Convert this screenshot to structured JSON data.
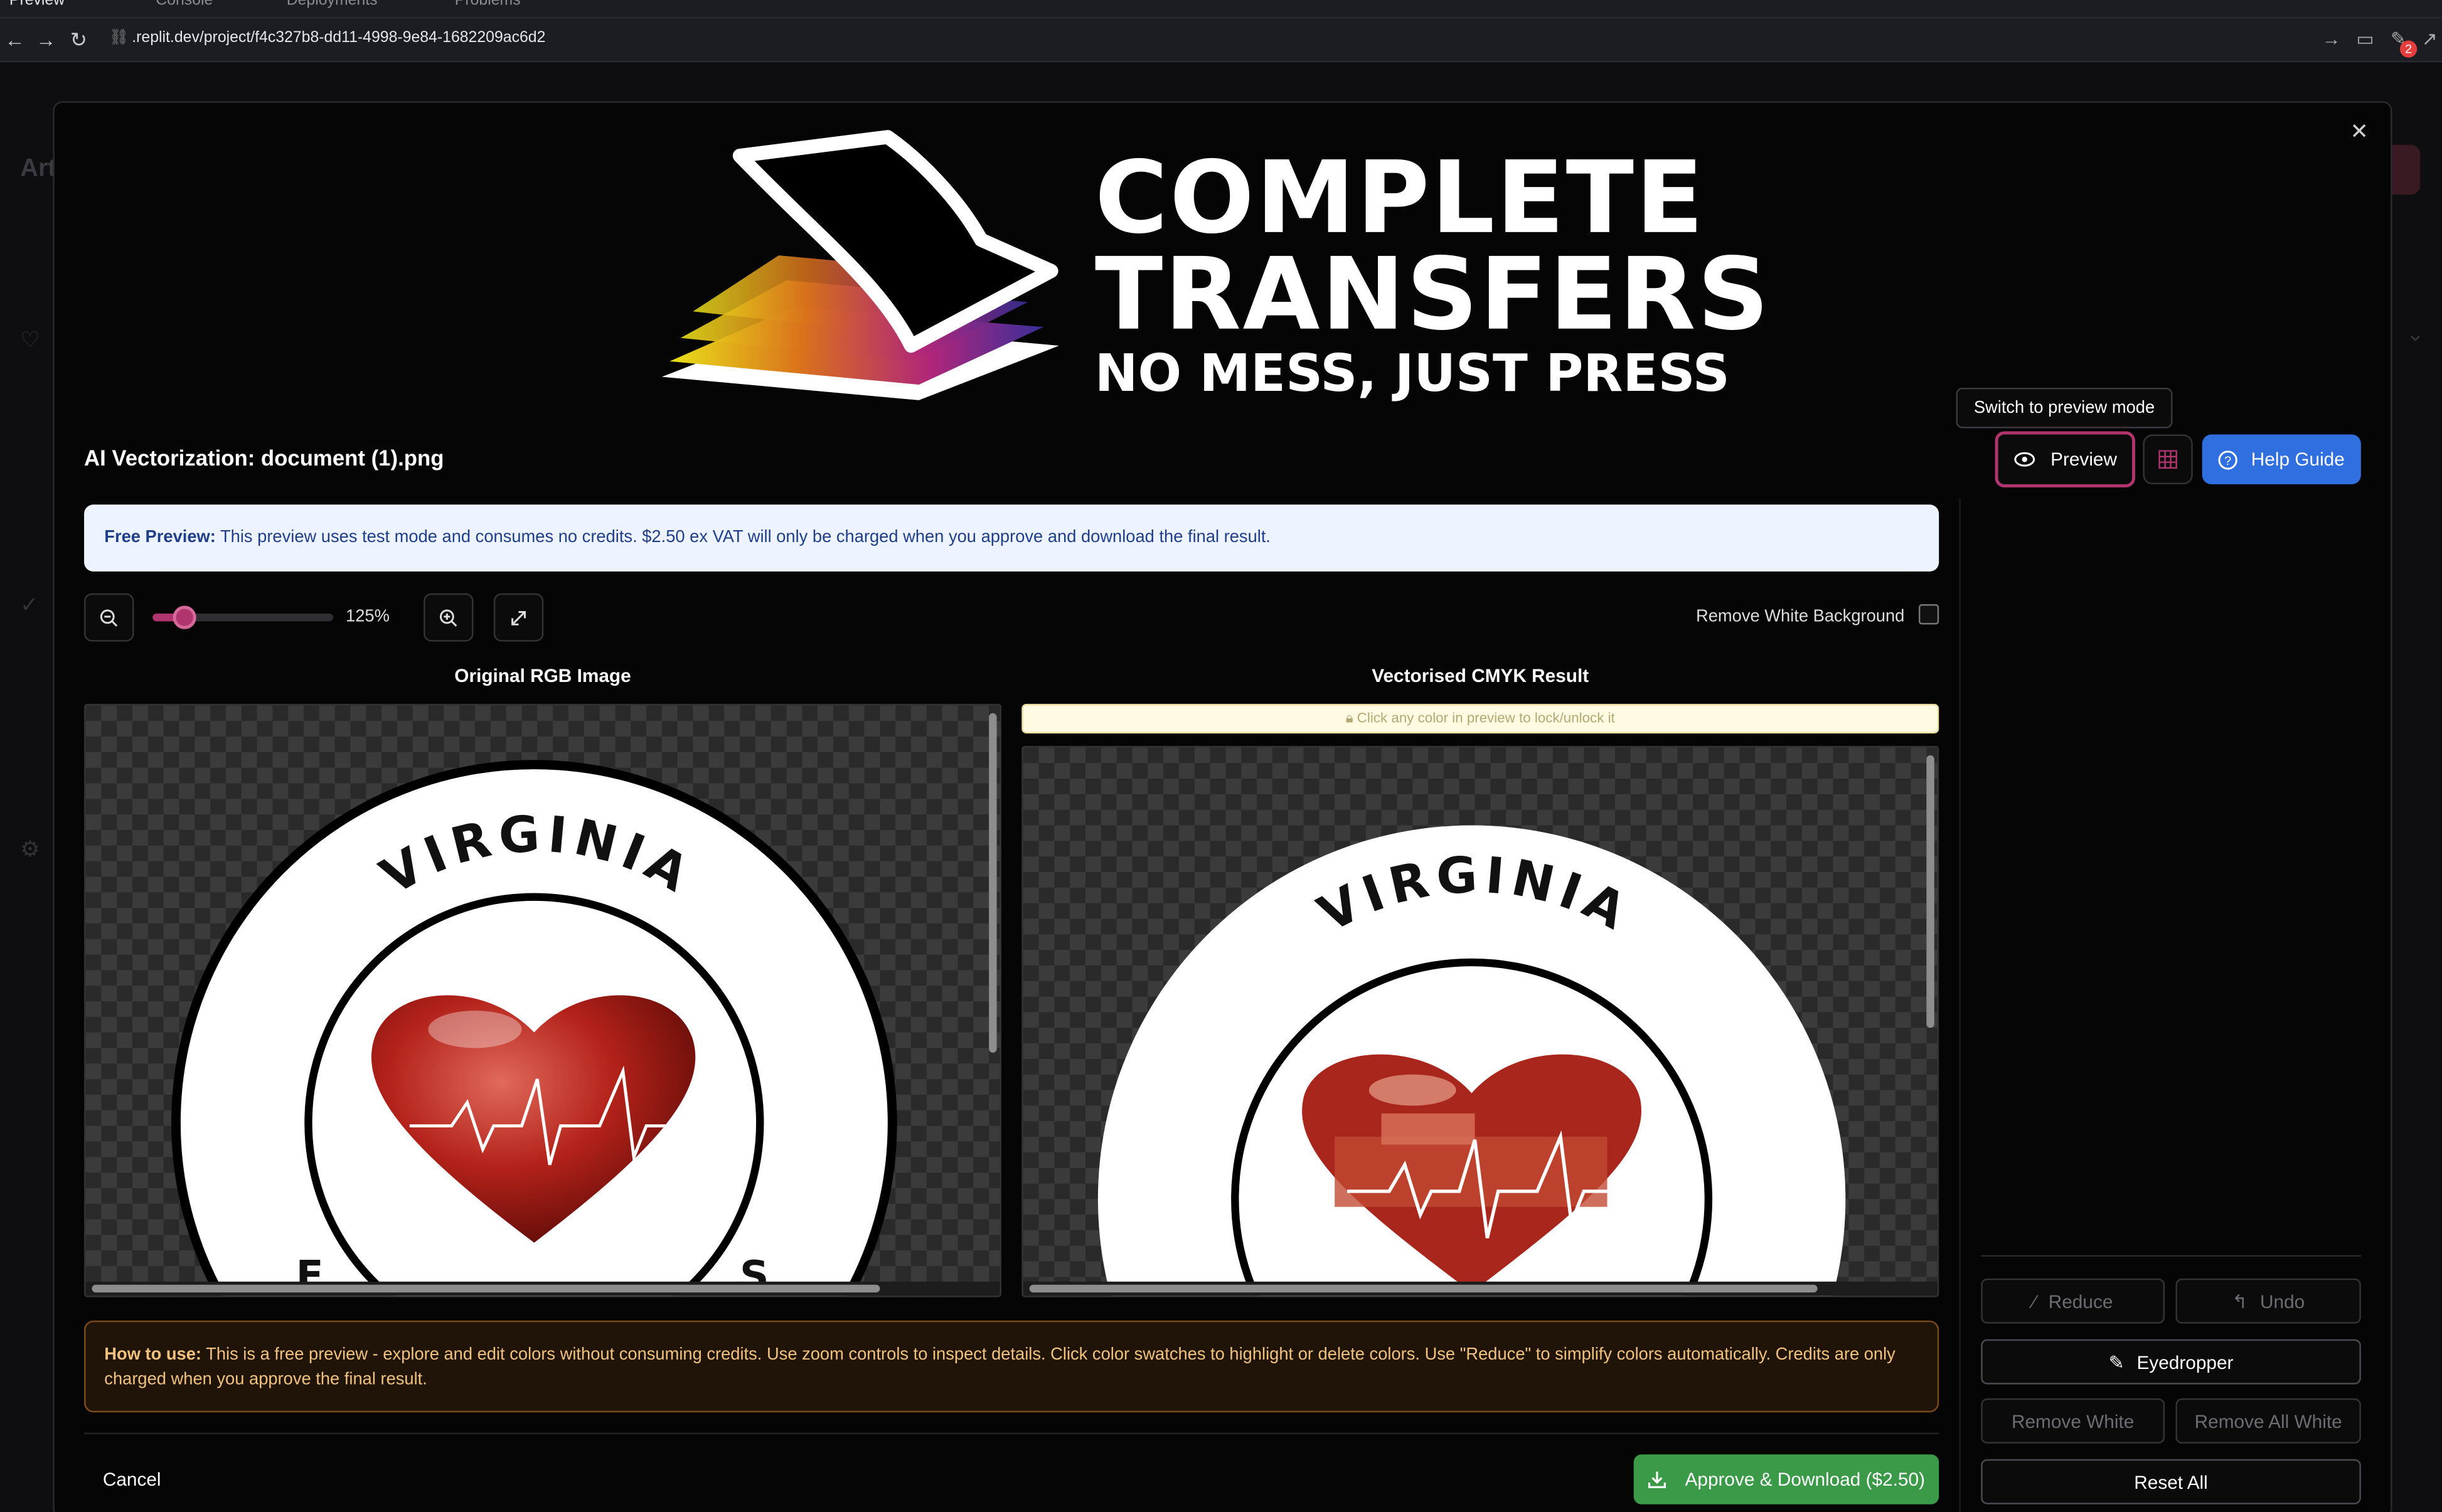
{
  "browser": {
    "tabs": [
      "Preview",
      "Console",
      "Deployments",
      "Problems"
    ],
    "url": ".replit.dev/project/f4c327b8-dd11-4998-9e84-1682209ac6d2",
    "notification_count": "2"
  },
  "background_app": {
    "title_fragment": "Art"
  },
  "logo": {
    "line1": "COMPLETE",
    "line2": "TRANSFERS",
    "line3": "NO MESS, JUST PRESS"
  },
  "dialog": {
    "title": "AI Vectorization: document (1).png",
    "tooltip": "Switch to preview mode",
    "preview_label": "Preview",
    "help_label": "Help Guide",
    "notice_strong": "Free Preview:",
    "notice_text": " This preview uses test mode and consumes no credits. $2.50 ex VAT will only be charged when you approve and download the final result.",
    "zoom_label": "125%",
    "zoom_fraction": 0.18,
    "remove_white_bg_label": "Remove White Background",
    "remove_white_bg_checked": false,
    "original_title": "Original RGB Image",
    "result_title": "Vectorised CMYK Result",
    "lock_hint": "Click any color in preview to lock/unlock it",
    "emblem_text": "VIRGINIA",
    "howto_strong": "How to use:",
    "howto_text": " This is a free preview - explore and edit colors without consuming credits. Use zoom controls to inspect details. Click color swatches to highlight or delete colors. Use \"Reduce\" to simplify colors automatically. Credits are only charged when you approve the final result.",
    "cancel_label": "Cancel",
    "approve_label": "Approve & Download ($2.50)"
  },
  "sidebar": {
    "reduce_label": "Reduce",
    "undo_label": "Undo",
    "eyedropper_label": "Eyedropper",
    "remove_white_label": "Remove White",
    "remove_all_white_label": "Remove All White",
    "reset_label": "Reset All"
  },
  "colors": {
    "accent": "#b0356f",
    "help_blue": "#2f6fe0",
    "approve_green": "#3a9a48"
  }
}
